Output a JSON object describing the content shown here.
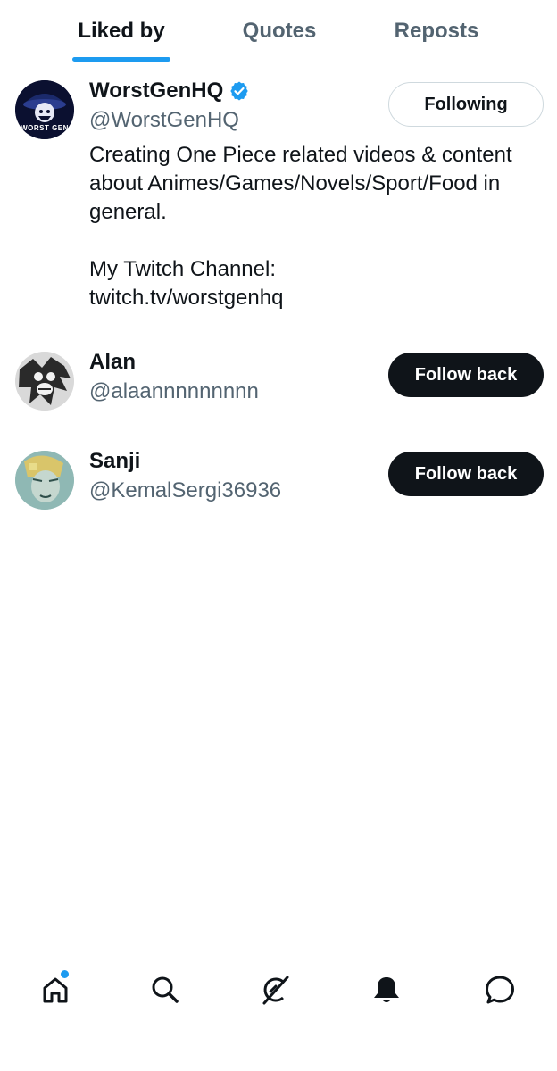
{
  "tabs": [
    {
      "label": "Liked by",
      "active": true
    },
    {
      "label": "Quotes",
      "active": false
    },
    {
      "label": "Reposts",
      "active": false
    }
  ],
  "users": [
    {
      "name": "WorstGenHQ",
      "handle": "@WorstGenHQ",
      "verified": true,
      "button": "Following",
      "bio_lines": [
        "Creating One Piece related videos & content",
        "about Animes/Games/Novels/Sport/Food in",
        "general.",
        "",
        "My Twitch Channel:",
        "twitch.tv/worstgenhq"
      ],
      "avatar_text": "WORST GEN"
    },
    {
      "name": "Alan",
      "handle": "@alaannnnnnnnn",
      "button": "Follow back"
    },
    {
      "name": "Sanji",
      "handle": "@KemalSergi36936",
      "button": "Follow back"
    }
  ],
  "bottom_nav": [
    {
      "icon": "home-icon",
      "has_notification_dot": true
    },
    {
      "icon": "search-icon"
    },
    {
      "icon": "grok-icon"
    },
    {
      "icon": "bell-icon"
    },
    {
      "icon": "messages-icon"
    }
  ],
  "colors": {
    "accent": "#1d9bf0",
    "text": "#0f1419",
    "muted": "#536471",
    "button_dark": "#0f1419"
  }
}
